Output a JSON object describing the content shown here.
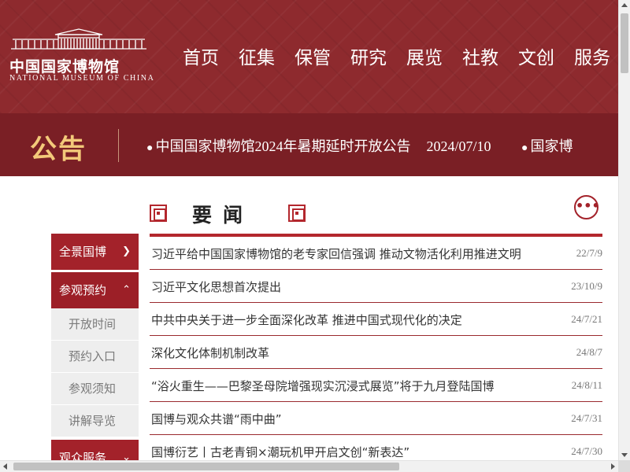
{
  "colors": {
    "header_bg": "#8e2a2e",
    "notice_bg": "#7a1f25",
    "accent": "#a3222a",
    "notice_label": "#f3c97a"
  },
  "logo": {
    "cn": "中国国家博物馆",
    "en": "NATIONAL MUSEUM OF CHINA",
    "icon": "museum-building-icon"
  },
  "nav": {
    "items": [
      {
        "label": "首页"
      },
      {
        "label": "征集"
      },
      {
        "label": "保管"
      },
      {
        "label": "研究"
      },
      {
        "label": "展览"
      },
      {
        "label": "社教"
      },
      {
        "label": "文创"
      },
      {
        "label": "服务"
      }
    ]
  },
  "notice": {
    "label": "公告",
    "items": [
      {
        "text": "中国国家博物馆2024年暑期延时开放公告",
        "date": "2024/07/10"
      },
      {
        "text": "国家博",
        "date": ""
      }
    ]
  },
  "section": {
    "title": "要闻",
    "more_icon": "more-dots-icon"
  },
  "sidebar": {
    "categories": [
      {
        "label": "全景国博",
        "chevron": "chevron-down-icon"
      },
      {
        "label": "参观预约",
        "chevron": "chevron-up-icon"
      }
    ],
    "sub_items": [
      {
        "label": "开放时间"
      },
      {
        "label": "预约入口"
      },
      {
        "label": "参观须知"
      },
      {
        "label": "讲解导览"
      }
    ],
    "bottom_category": {
      "label": "观众服务",
      "chevron": "chevron-down-icon"
    }
  },
  "news": [
    {
      "title": "习近平给中国国家博物馆的老专家回信强调 推动文物活化利用推进文明",
      "date": "22/7/9"
    },
    {
      "title": "习近平文化思想首次提出",
      "date": "23/10/9"
    },
    {
      "title": "中共中央关于进一步全面深化改革 推进中国式现代化的决定",
      "date": "24/7/21"
    },
    {
      "title": "深化文化体制机制改革",
      "date": "24/8/7"
    },
    {
      "title": "“浴火重生——巴黎圣母院增强现实沉浸式展览”将于九月登陆国博",
      "date": "24/8/11"
    },
    {
      "title": "国博与观众共谱“雨中曲”",
      "date": "24/7/31"
    },
    {
      "title": "国博衍艺丨古老青铜×潮玩机甲开启文创“新表达”",
      "date": "24/7/30"
    }
  ]
}
